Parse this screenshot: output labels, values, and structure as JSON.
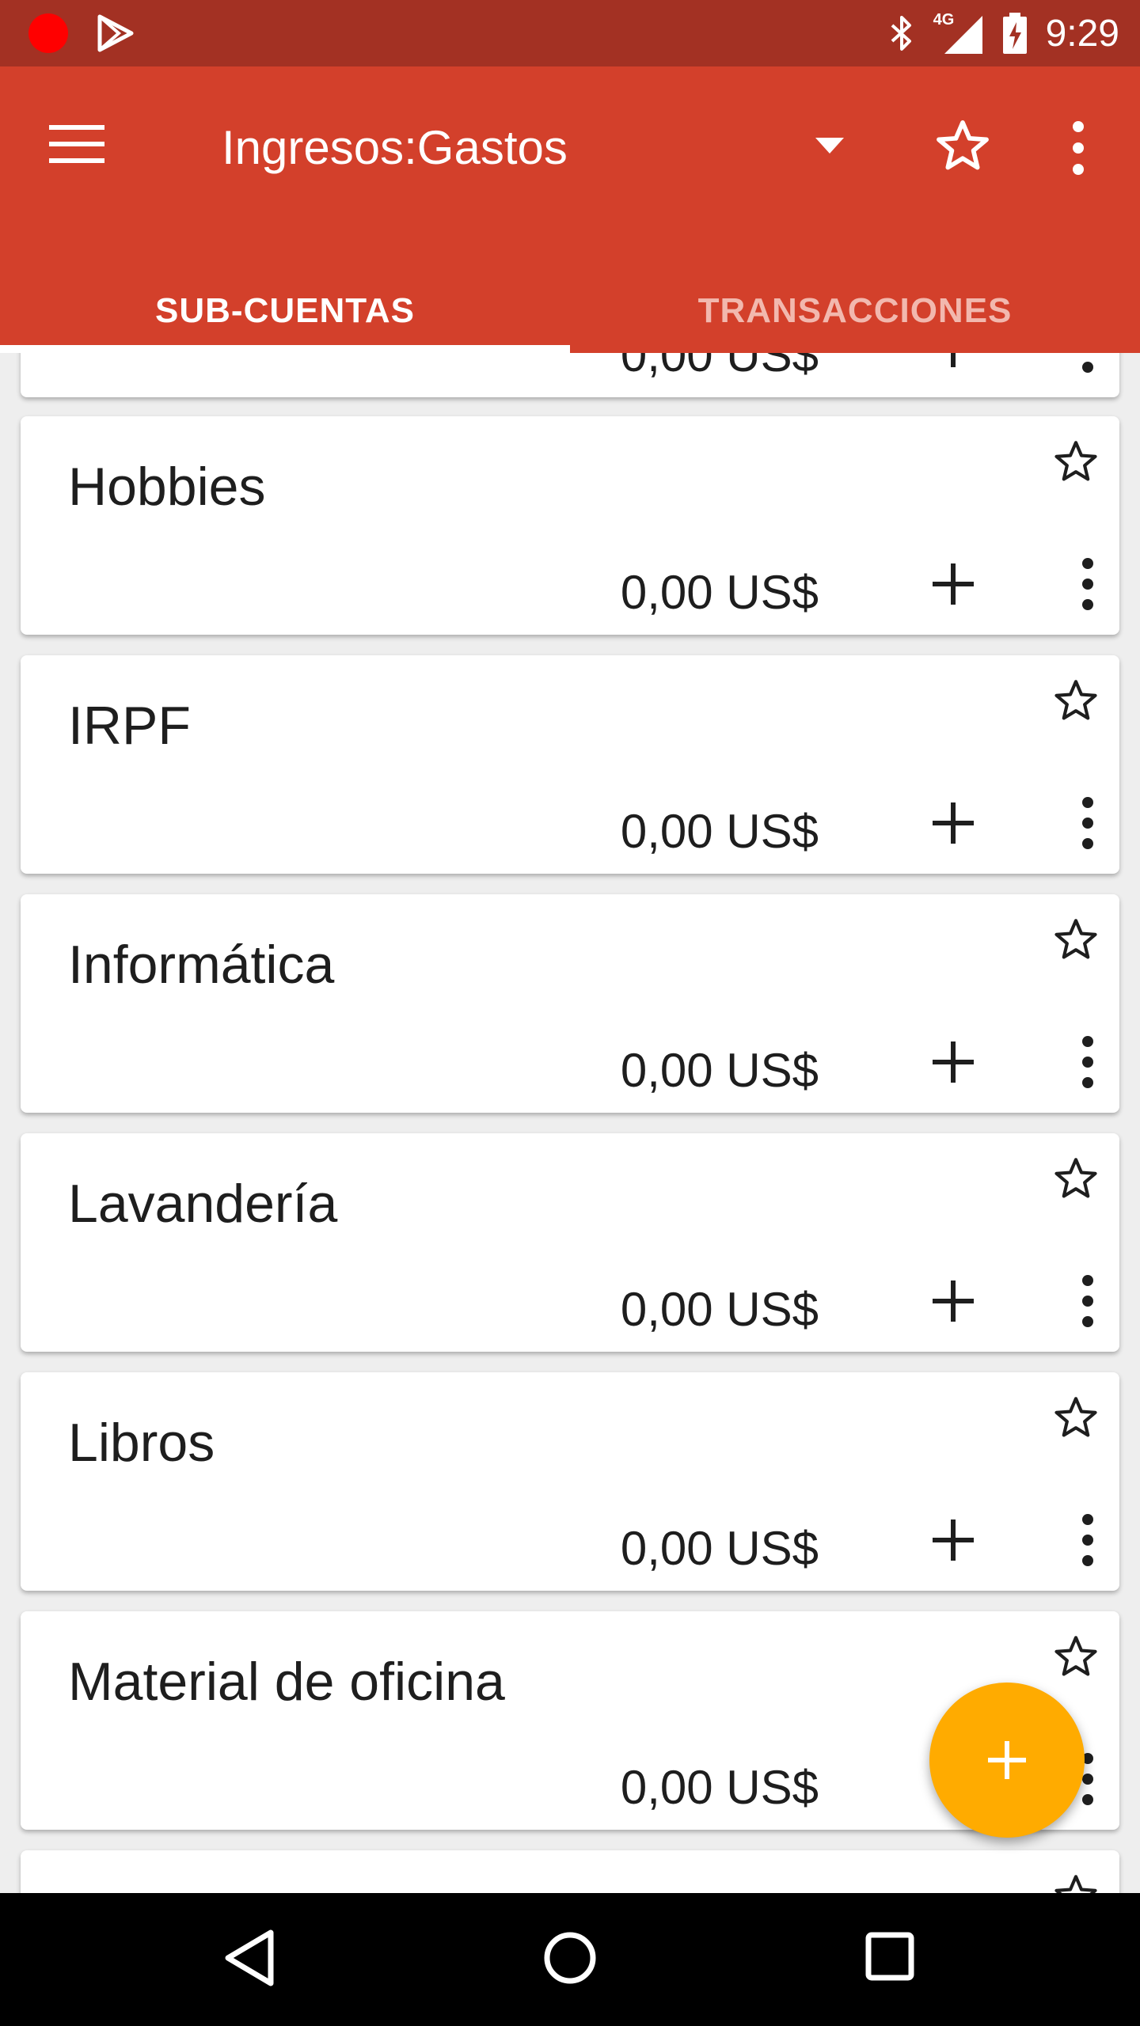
{
  "status_bar": {
    "time": "9:29",
    "network": "4G",
    "colors": {
      "background": "#a33123"
    }
  },
  "toolbar": {
    "title": "Ingresos:Gastos",
    "icons": [
      "menu-icon",
      "dropdown-icon",
      "star-outline-icon",
      "overflow-menu-icon"
    ],
    "colors": {
      "background": "#d3402b"
    }
  },
  "tabs": [
    {
      "label": "SUB-CUENTAS",
      "active": true
    },
    {
      "label": "TRANSACCIONES",
      "active": false
    }
  ],
  "partial_top_card": {
    "amount": "0,00 US$"
  },
  "accounts": [
    {
      "name": "Hobbies",
      "amount": "0,00 US$"
    },
    {
      "name": "IRPF",
      "amount": "0,00 US$"
    },
    {
      "name": "Informática",
      "amount": "0,00 US$"
    },
    {
      "name": "Lavandería",
      "amount": "0,00 US$"
    },
    {
      "name": "Libros",
      "amount": "0,00 US$"
    },
    {
      "name": "Material de oficina",
      "amount": "0,00 US$"
    }
  ],
  "fab": {
    "icon": "plus-icon",
    "color": "#ffab00"
  },
  "nav_bar": {
    "icons": [
      "back-icon",
      "home-icon",
      "recents-icon"
    ]
  }
}
